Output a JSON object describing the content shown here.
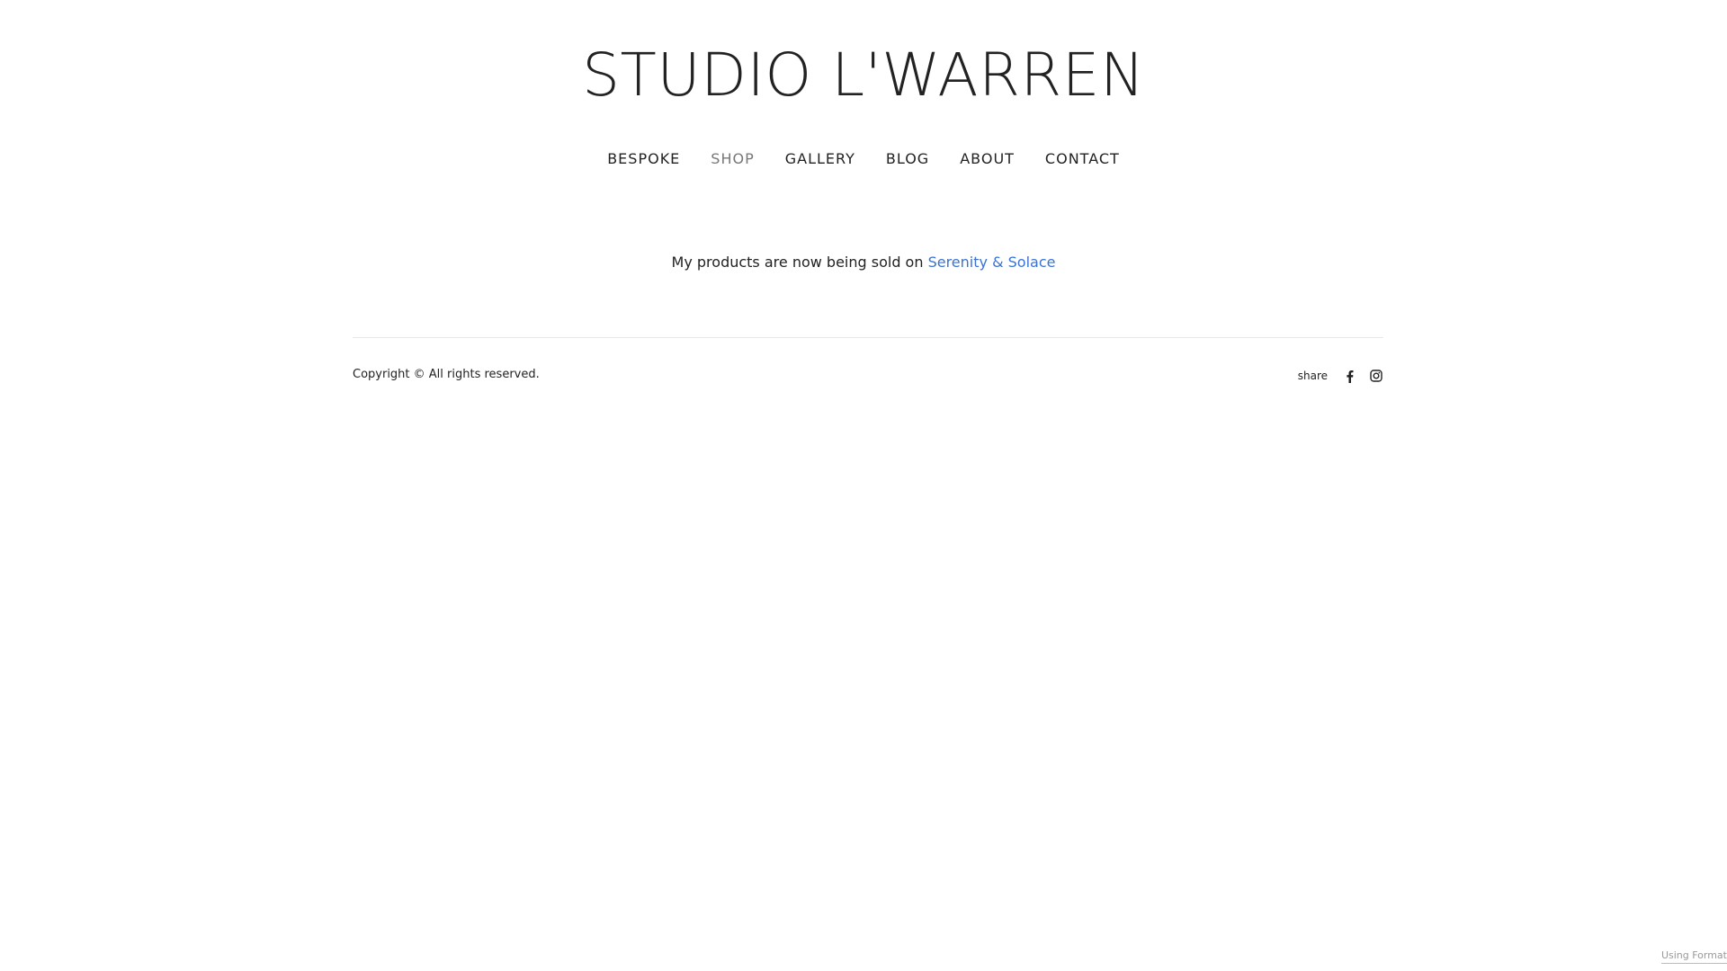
{
  "header": {
    "site_title": "STUDIO L'WARREN"
  },
  "nav": {
    "items": [
      {
        "label": "BESPOKE",
        "active": false
      },
      {
        "label": "SHOP",
        "active": true
      },
      {
        "label": "GALLERY",
        "active": false
      },
      {
        "label": "BLOG",
        "active": false
      },
      {
        "label": "ABOUT",
        "active": false
      },
      {
        "label": "CONTACT",
        "active": false
      }
    ]
  },
  "main": {
    "notice_text": "My products are now being sold on ",
    "notice_link": "Serenity & Solace"
  },
  "footer": {
    "copyright": "Copyright © All rights reserved.",
    "share_label": "share",
    "social_icons": [
      "facebook-icon",
      "instagram-icon"
    ]
  },
  "badge": {
    "using_format": "Using Format"
  },
  "colors": {
    "text": "#222222",
    "nav_active": "#777777",
    "link": "#3a73d6",
    "divider": "#e8e8e8",
    "badge": "#999999"
  }
}
